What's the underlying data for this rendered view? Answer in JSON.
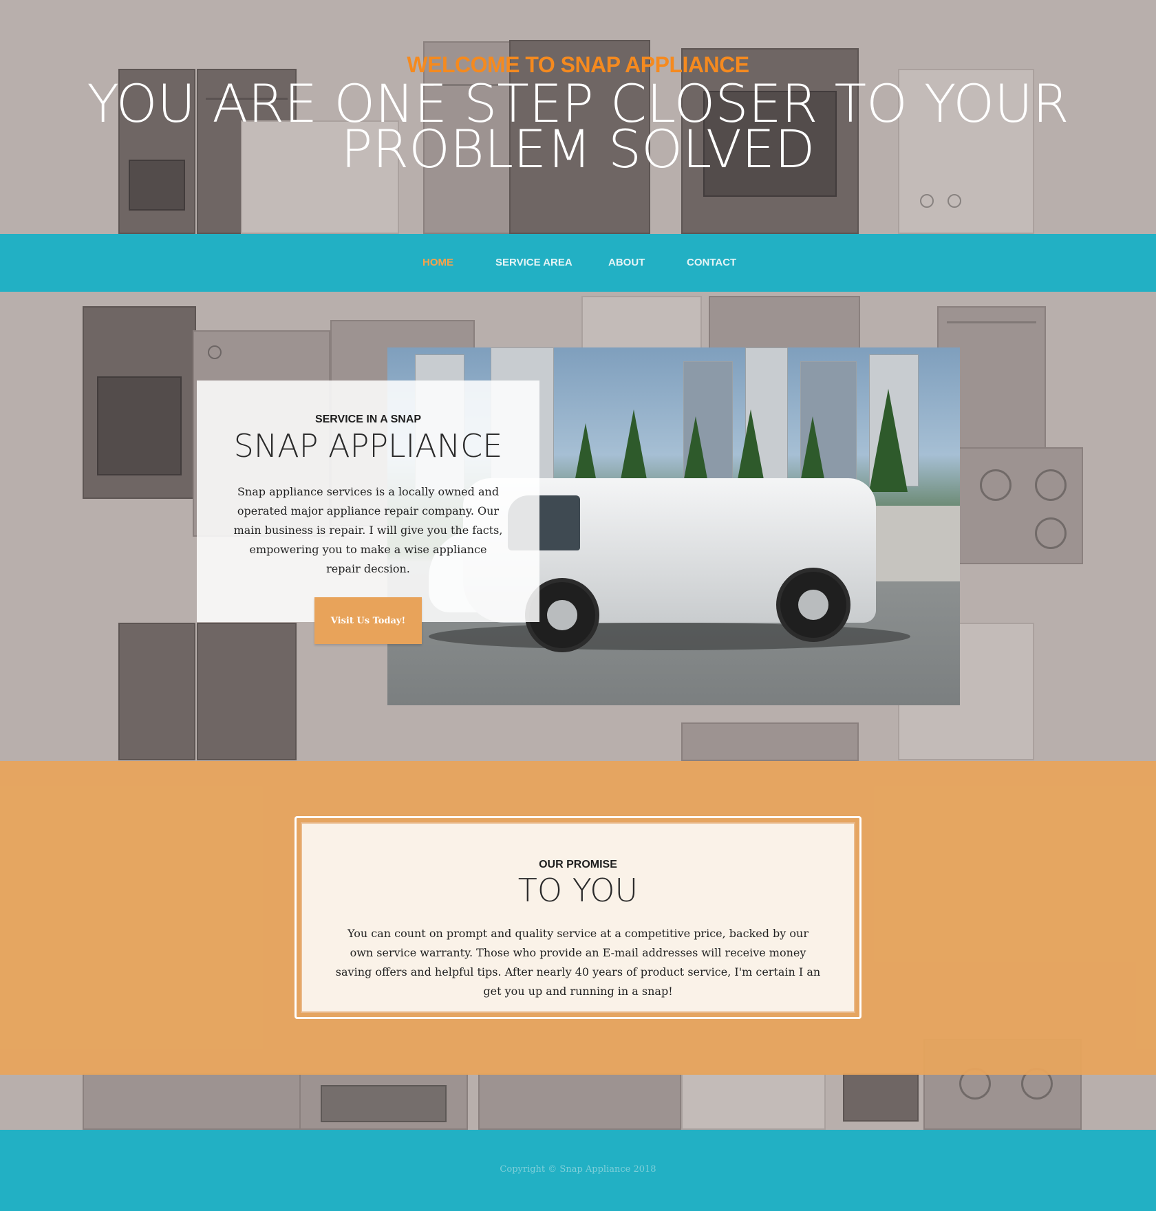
{
  "hero": {
    "welcome": "WELCOME TO SNAP APPLIANCE",
    "headline_line1": "YOU ARE ONE STEP CLOSER TO YOUR",
    "headline_line2": "PROBLEM SOLVED"
  },
  "nav": {
    "items": [
      {
        "label": "HOME",
        "active": true
      },
      {
        "label": "SERVICE AREA",
        "active": false
      },
      {
        "label": "ABOUT",
        "active": false
      },
      {
        "label": "CONTACT",
        "active": false
      }
    ]
  },
  "feature": {
    "eyebrow": "SERVICE IN A SNAP",
    "title": "SNAP APPLIANCE",
    "text": "Snap appliance services is a locally owned and operated major appliance repair company. Our main business is repair. I will give you the facts, empowering you to make a wise appliance repair decsion.",
    "cta_label": "Visit Us Today!"
  },
  "promise": {
    "eyebrow": "OUR PROMISE",
    "title": "TO YOU",
    "text": "You can count on prompt and quality service at a competitive price, backed by our own service warranty. Those who provide an E-mail addresses will receive money saving offers and helpful tips. After nearly 40 years of product service, I'm certain I an get you up and running in a snap!"
  },
  "footer": {
    "copyright": "Copyright © Snap Appliance 2018"
  },
  "colors": {
    "accent_orange": "#f58a1f",
    "nav_teal": "#1cb0c5",
    "button_orange": "#e8a35a",
    "band_orange": "#e8a55c"
  }
}
